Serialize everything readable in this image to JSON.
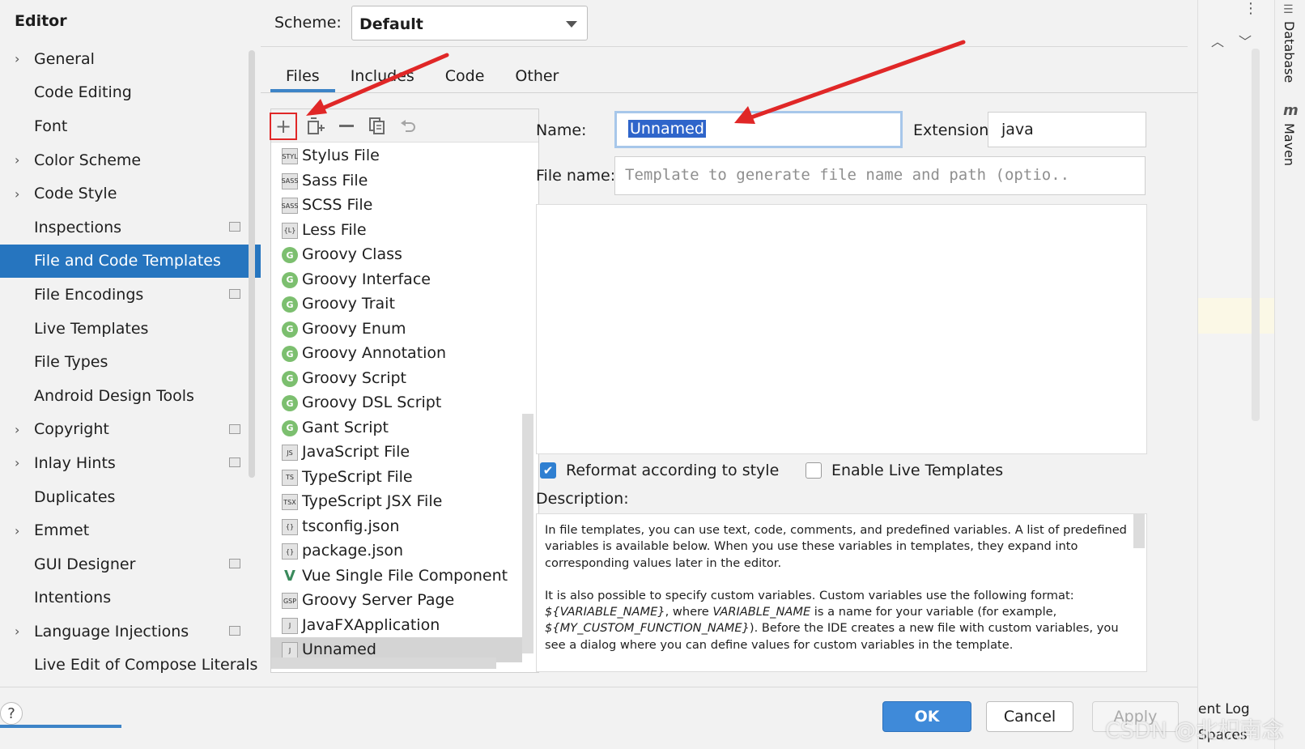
{
  "sidebar": {
    "title": "Editor",
    "items": [
      {
        "label": "General",
        "expandable": true,
        "project_icon": false
      },
      {
        "label": "Code Editing",
        "expandable": false,
        "project_icon": false
      },
      {
        "label": "Font",
        "expandable": false,
        "project_icon": false
      },
      {
        "label": "Color Scheme",
        "expandable": true,
        "project_icon": false
      },
      {
        "label": "Code Style",
        "expandable": true,
        "project_icon": false
      },
      {
        "label": "Inspections",
        "expandable": false,
        "project_icon": true
      },
      {
        "label": "File and Code Templates",
        "expandable": false,
        "project_icon": false,
        "selected": true
      },
      {
        "label": "File Encodings",
        "expandable": false,
        "project_icon": true
      },
      {
        "label": "Live Templates",
        "expandable": false,
        "project_icon": false
      },
      {
        "label": "File Types",
        "expandable": false,
        "project_icon": false
      },
      {
        "label": "Android Design Tools",
        "expandable": false,
        "project_icon": false
      },
      {
        "label": "Copyright",
        "expandable": true,
        "project_icon": true
      },
      {
        "label": "Inlay Hints",
        "expandable": true,
        "project_icon": true
      },
      {
        "label": "Duplicates",
        "expandable": false,
        "project_icon": false
      },
      {
        "label": "Emmet",
        "expandable": true,
        "project_icon": false
      },
      {
        "label": "GUI Designer",
        "expandable": false,
        "project_icon": true
      },
      {
        "label": "Intentions",
        "expandable": false,
        "project_icon": false
      },
      {
        "label": "Language Injections",
        "expandable": true,
        "project_icon": true
      },
      {
        "label": "Live Edit of Compose Literals",
        "expandable": false,
        "project_icon": false
      }
    ]
  },
  "scheme": {
    "label": "Scheme:",
    "value": "Default"
  },
  "tabs": [
    {
      "label": "Files",
      "active": true
    },
    {
      "label": "Includes",
      "active": false
    },
    {
      "label": "Code",
      "active": false
    },
    {
      "label": "Other",
      "active": false
    }
  ],
  "toolbar_icons": [
    "add-icon",
    "copy-template-icon",
    "remove-icon",
    "duplicate-icon",
    "reset-icon"
  ],
  "templates": [
    {
      "label": "Stylus File",
      "icon": "STYL",
      "kind": "file"
    },
    {
      "label": "Sass File",
      "icon": "SASS",
      "kind": "file"
    },
    {
      "label": "SCSS File",
      "icon": "SASS",
      "kind": "file"
    },
    {
      "label": "Less File",
      "icon": "{L}",
      "kind": "file"
    },
    {
      "label": "Groovy Class",
      "icon": "G",
      "kind": "groovy"
    },
    {
      "label": "Groovy Interface",
      "icon": "G",
      "kind": "groovy"
    },
    {
      "label": "Groovy Trait",
      "icon": "G",
      "kind": "groovy"
    },
    {
      "label": "Groovy Enum",
      "icon": "G",
      "kind": "groovy"
    },
    {
      "label": "Groovy Annotation",
      "icon": "G",
      "kind": "groovy"
    },
    {
      "label": "Groovy Script",
      "icon": "G",
      "kind": "groovy"
    },
    {
      "label": "Groovy DSL Script",
      "icon": "G",
      "kind": "groovy"
    },
    {
      "label": "Gant Script",
      "icon": "G",
      "kind": "groovy"
    },
    {
      "label": "JavaScript File",
      "icon": "JS",
      "kind": "file"
    },
    {
      "label": "TypeScript File",
      "icon": "TS",
      "kind": "file"
    },
    {
      "label": "TypeScript JSX File",
      "icon": "TSX",
      "kind": "file"
    },
    {
      "label": "tsconfig.json",
      "icon": "{}",
      "kind": "file"
    },
    {
      "label": "package.json",
      "icon": "{}",
      "kind": "file"
    },
    {
      "label": "Vue Single File Component",
      "icon": "V",
      "kind": "vue"
    },
    {
      "label": "Groovy Server Page",
      "icon": "GSP",
      "kind": "file"
    },
    {
      "label": "JavaFXApplication",
      "icon": "J",
      "kind": "file"
    },
    {
      "label": "Unnamed",
      "icon": "J",
      "kind": "file",
      "selected": true
    }
  ],
  "form": {
    "name_label": "Name:",
    "name_value": "Unnamed",
    "extension_label": "Extension:",
    "extension_value": "java",
    "file_name_label": "File name:",
    "file_name_placeholder": "Template to generate file name and path (optio.."
  },
  "options": {
    "reformat_label": "Reformat according to style",
    "reformat_checked": true,
    "live_templates_label": "Enable Live Templates",
    "live_templates_checked": false
  },
  "description": {
    "label": "Description:",
    "para1": "In file templates, you can use text, code, comments, and predefined variables. A list of predefined variables is available below. When you use these variables in templates, they expand into corresponding values later in the editor.",
    "para2_a": "It is also possible to specify custom variables. Custom variables use the following format: ",
    "para2_b": "${VARIABLE_NAME}",
    "para2_c": ", where ",
    "para2_d": "VARIABLE_NAME",
    "para2_e": " is a name for your variable (for example, ",
    "para2_f": "${MY_CUSTOM_FUNCTION_NAME}",
    "para2_g": "). Before the IDE creates a new file with custom variables, you see a dialog where you can define values for custom variables in the template."
  },
  "buttons": {
    "help": "?",
    "ok": "OK",
    "cancel": "Cancel",
    "apply": "Apply"
  },
  "ide": {
    "database_label": "Database",
    "maven_label": "Maven",
    "event_log_label": "ent Log",
    "spaces_label": "Spaces",
    "more_icon": "⋮"
  },
  "watermark": "CSDN @北枳南念",
  "colors": {
    "accent": "#2675bf",
    "arrow": "#e02727",
    "highlight_box": "#e02727"
  }
}
